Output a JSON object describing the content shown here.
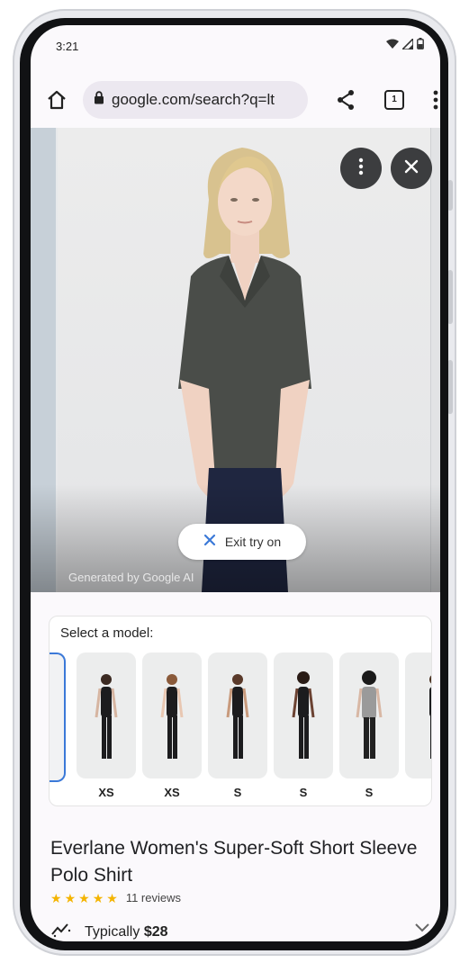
{
  "status_bar": {
    "time": "3:21"
  },
  "browser": {
    "url": "google.com/search?q=lt",
    "tab_count": "1"
  },
  "hero": {
    "exit_label": "Exit try on",
    "caption": "Generated by Google AI"
  },
  "model_picker": {
    "label": "Select a model:",
    "sizes": [
      "XS",
      "XS",
      "S",
      "S",
      "S"
    ]
  },
  "product": {
    "title": "Everlane Women's Super-Soft Short Sleeve Polo Shirt",
    "stars": 5,
    "reviews": "11 reviews",
    "price_prefix": "Typically",
    "price": "$28"
  },
  "colors": {
    "accent": "#3b79d8",
    "star": "#f4b400",
    "shirt": "#4a4d49",
    "pants": "#1f2640"
  },
  "icons": [
    "home-icon",
    "lock-icon",
    "share-icon",
    "tabs-icon",
    "more-vert-icon",
    "close-icon",
    "wifi-icon",
    "signal-icon",
    "battery-icon",
    "trend-icon",
    "chevron-down-icon"
  ]
}
